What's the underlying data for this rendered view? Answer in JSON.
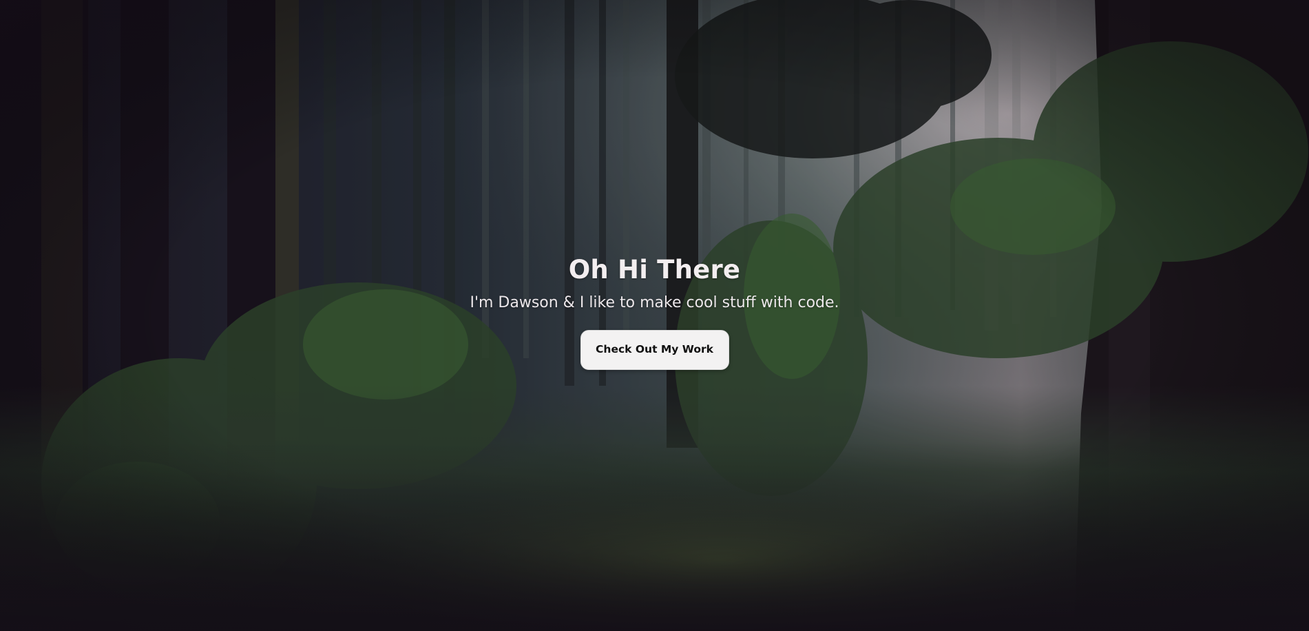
{
  "hero": {
    "title": "Oh Hi There",
    "subtitle": "I'm Dawson & I like to make cool stuff with code.",
    "cta_label": "Check Out My Work",
    "background_image": "misty-forest-image"
  },
  "colors": {
    "text": "#f3eef0",
    "button_bg": "#f3f2f2",
    "button_text": "#111111",
    "background_dark": "#1b1520"
  }
}
